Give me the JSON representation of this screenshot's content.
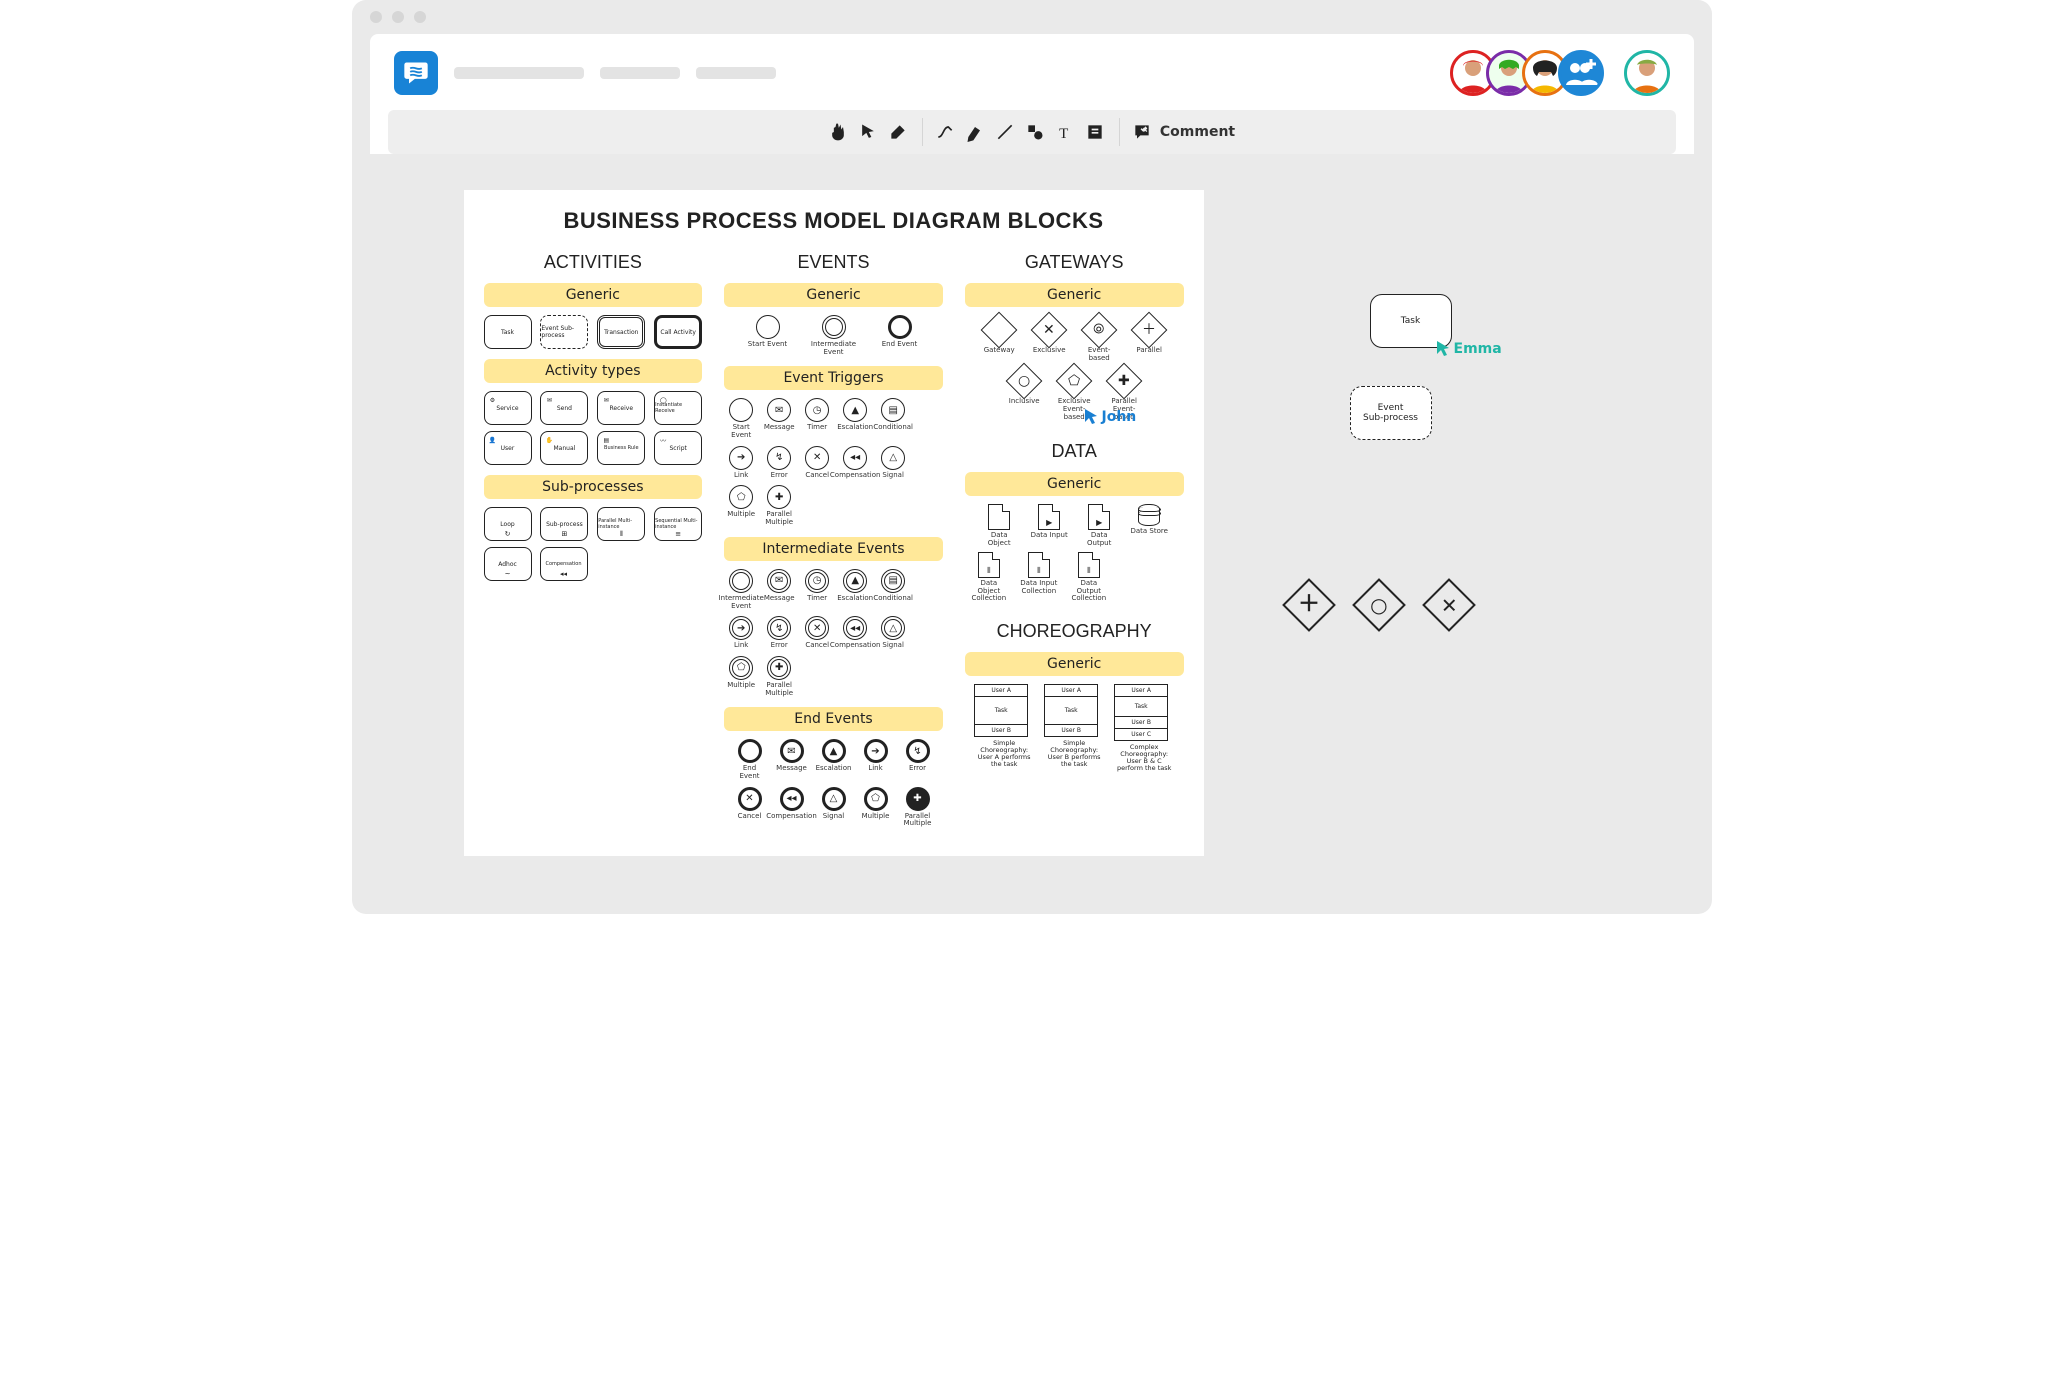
{
  "toolbar": {
    "comment_label": "Comment"
  },
  "users": {
    "emma": "Emma",
    "john": "John"
  },
  "stage": {
    "task": "Task",
    "event_subprocess": "Event\nSub-process"
  },
  "palette": {
    "title": "BUSINESS PROCESS MODEL DIAGRAM BLOCKS",
    "activities_heading": "ACTIVITIES",
    "events_heading": "EVENTS",
    "gateways_heading": "GATEWAYS",
    "data_heading": "DATA",
    "choreography_heading": "CHOREOGRAPHY",
    "generic": "Generic",
    "activity_types": "Activity types",
    "sub_processes": "Sub-processes",
    "event_triggers": "Event Triggers",
    "intermediate_events": "Intermediate Events",
    "end_events": "End Events",
    "activities": {
      "generic": [
        "Task",
        "Event Sub-process",
        "Transaction",
        "Call Activity"
      ],
      "types": [
        "Service",
        "Send",
        "Receive",
        "Instantiate Receive",
        "User",
        "Manual",
        "Business Rule",
        "Script"
      ],
      "sub": [
        "Loop",
        "Sub-process",
        "Parallel Multi-instance",
        "Sequential Multi-instance",
        "Adhoc",
        "Compensation"
      ]
    },
    "events": {
      "generic": [
        "Start Event",
        "Intermediate Event",
        "End Event"
      ],
      "triggers": [
        "Start Event",
        "Message",
        "Timer",
        "Escalation",
        "Conditional",
        "Link",
        "Error",
        "Cancel",
        "Compensation",
        "Signal",
        "Multiple",
        "Parallel Multiple"
      ],
      "intermediate": [
        "Intermediate Event",
        "Message",
        "Timer",
        "Escalation",
        "Conditional",
        "Link",
        "Error",
        "Cancel",
        "Compensation",
        "Signal",
        "Multiple",
        "Parallel Multiple"
      ],
      "end": [
        "End Event",
        "Message",
        "Escalation",
        "Link",
        "Error",
        "Cancel",
        "Compensation",
        "Signal",
        "Multiple",
        "Parallel Multiple"
      ]
    },
    "gateways": {
      "generic": [
        "Gateway",
        "Exclusive",
        "Event-based",
        "Parallel",
        "Inclusive",
        "Exclusive Event-based",
        "Parallel Event-based"
      ]
    },
    "data": {
      "generic": [
        "Data Object",
        "Data Input",
        "Data Output",
        "Data Store",
        "Data Object Collection",
        "Data Input Collection",
        "Data Output Collection"
      ]
    },
    "choreo": {
      "simpleA": {
        "rows": [
          "User A",
          "Task",
          "User B"
        ],
        "caption": "Simple Choreography: User A performs the task"
      },
      "simpleB": {
        "rows": [
          "User A",
          "Task",
          "User B"
        ],
        "caption": "Simple Choreography: User B performs the task"
      },
      "complex": {
        "rows": [
          "User A",
          "Task",
          "User B",
          "User C"
        ],
        "caption": "Complex Choreography: User B & C perform the task"
      }
    }
  }
}
